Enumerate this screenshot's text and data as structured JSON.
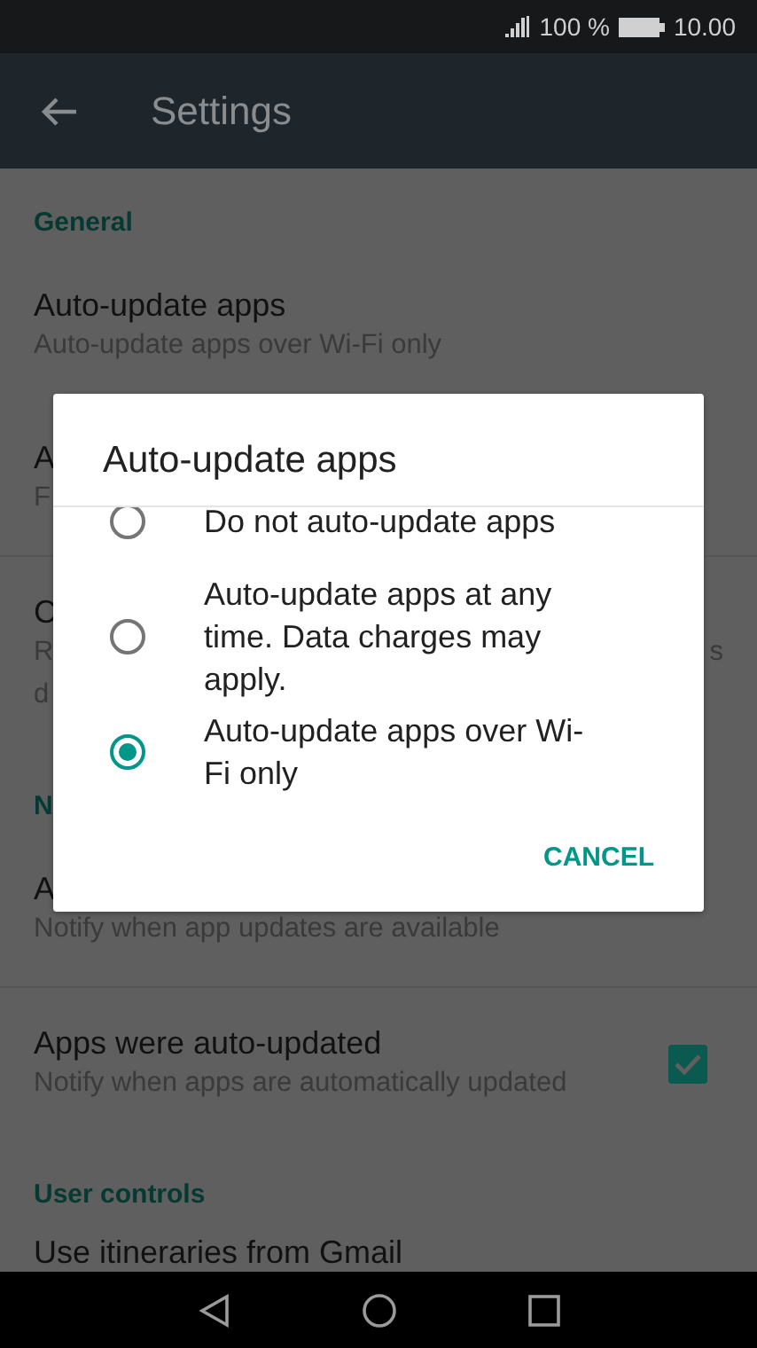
{
  "status_bar": {
    "battery": "100 %",
    "time": "10.00"
  },
  "app_bar": {
    "title": "Settings"
  },
  "settings": [
    {
      "kind": "section",
      "title": "General"
    },
    {
      "kind": "item",
      "title": "Auto-update apps",
      "subtitle": [
        "Auto-update apps over Wi-Fi only"
      ]
    },
    {
      "kind": "item",
      "title": "A",
      "subtitle": [
        "F"
      ]
    },
    {
      "kind": "divider"
    },
    {
      "kind": "item",
      "title": "C",
      "subtitle": [
        "R",
        "d"
      ],
      "subtitle_right": "s"
    },
    {
      "kind": "section",
      "title": "N"
    },
    {
      "kind": "item",
      "title": "A",
      "subtitle": [
        "Notify when app updates are available"
      ]
    },
    {
      "kind": "divider"
    },
    {
      "kind": "item",
      "title": "Apps were auto-updated",
      "subtitle": [
        "Notify when apps are automatically updated"
      ],
      "checked": true
    },
    {
      "kind": "section",
      "title": "User controls"
    },
    {
      "kind": "item",
      "title": "Use itineraries from Gmail"
    }
  ],
  "dialog": {
    "title": "Auto-update apps",
    "options": [
      {
        "label": "Do not auto-update apps",
        "selected": false
      },
      {
        "label": "Auto-update apps at any time. Data charges may apply.",
        "selected": false
      },
      {
        "label": "Auto-update apps over Wi-Fi only",
        "selected": true
      }
    ],
    "button": "CANCEL"
  }
}
